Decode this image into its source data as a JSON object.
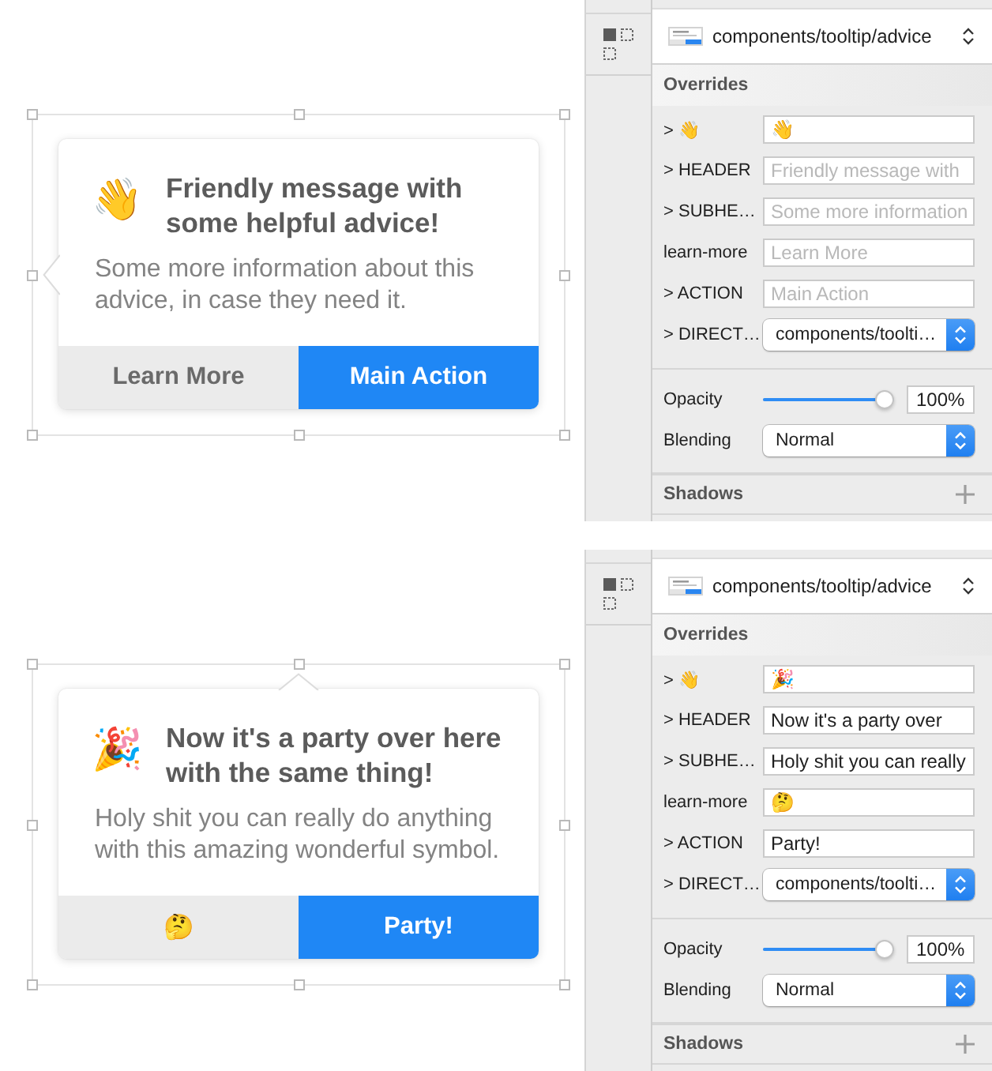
{
  "screens": [
    {
      "tooltip": {
        "selected": true,
        "kind": "left",
        "icon": "👋",
        "header": "Friendly message with some helpful advice!",
        "subheader": "Some more information about this advice, in case they need it.",
        "buttons": [
          {
            "label": "Learn More",
            "kind": "secondary"
          },
          {
            "label": "Main Action",
            "kind": "primary"
          }
        ]
      },
      "inspector": {
        "symbol": "components/tooltip/advice",
        "overrides": {
          "title": "Overrides",
          "rows": [
            {
              "label": "> 👋",
              "kind": "text",
              "value": "👋"
            },
            {
              "label": "> HEADER",
              "kind": "text",
              "placeholder": "Friendly message with"
            },
            {
              "label": "> SUBHE…",
              "kind": "text",
              "placeholder": "Some more information"
            },
            {
              "label": "learn-more",
              "kind": "text",
              "placeholder": "Learn More"
            },
            {
              "label": "> ACTION",
              "kind": "text",
              "placeholder": "Main Action"
            },
            {
              "label": "> DIRECT…",
              "kind": "select",
              "value": "components/toolti…"
            }
          ]
        },
        "opacity": {
          "label": "Opacity",
          "level": 1,
          "value": "100%"
        },
        "blending": {
          "label": "Blending",
          "value": "Normal"
        },
        "shadows": {
          "title": "Shadows"
        }
      }
    },
    {
      "tooltip": {
        "selected": true,
        "kind": "top",
        "icon": "🎉",
        "header": "Now it's a party over here with the same thing!",
        "subheader": "Holy shit you can really do anything with this amazing wonderful symbol.",
        "buttons": [
          {
            "label": "🤔",
            "kind": "secondary"
          },
          {
            "label": "Party!",
            "kind": "primary"
          }
        ]
      },
      "inspector": {
        "symbol": "components/tooltip/advice",
        "overrides": {
          "title": "Overrides",
          "rows": [
            {
              "label": "> 👋",
              "kind": "text",
              "value": "🎉"
            },
            {
              "label": "> HEADER",
              "kind": "text",
              "value": "Now it's a party over"
            },
            {
              "label": "> SUBHE…",
              "kind": "text",
              "value": "Holy shit you can really"
            },
            {
              "label": "learn-more",
              "kind": "text",
              "value": "🤔"
            },
            {
              "label": "> ACTION",
              "kind": "text",
              "value": "Party!"
            },
            {
              "label": "> DIRECT…",
              "kind": "select",
              "value": "components/toolti…"
            }
          ]
        },
        "opacity": {
          "label": "Opacity",
          "level": 1,
          "value": "100%"
        },
        "blending": {
          "label": "Blending",
          "value": "Normal"
        },
        "shadows": {
          "title": "Shadows"
        }
      }
    }
  ]
}
